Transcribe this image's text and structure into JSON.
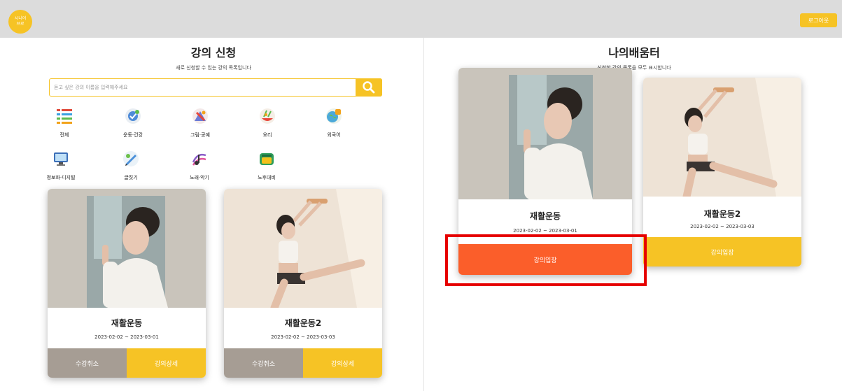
{
  "header": {
    "logo_text": "시니어 브로",
    "logout_label": "로그아웃"
  },
  "apply": {
    "title": "강의 신청",
    "subtitle": "새로 신청할 수 있는 강의 목록입니다",
    "search": {
      "placeholder": "듣고 싶은 강의 이름을 입력해주세요",
      "value": ""
    },
    "categories": [
      {
        "label": "전체",
        "icon": "list-icon"
      },
      {
        "label": "운동·건강",
        "icon": "health-icon"
      },
      {
        "label": "그림·공예",
        "icon": "art-icon"
      },
      {
        "label": "요리",
        "icon": "cooking-icon"
      },
      {
        "label": "외국어",
        "icon": "language-icon"
      },
      {
        "label": "정보화·디지털",
        "icon": "computer-icon"
      },
      {
        "label": "글짓기",
        "icon": "writing-icon"
      },
      {
        "label": "노래·악기",
        "icon": "music-icon"
      },
      {
        "label": "노후대비",
        "icon": "savings-icon"
      }
    ],
    "courses": [
      {
        "name": "재활운동",
        "period": "2023-02-02 ~ 2023-03-01",
        "cancel_label": "수강취소",
        "detail_label": "강의상세"
      },
      {
        "name": "재활운동2",
        "period": "2023-02-02 ~ 2023-03-03",
        "cancel_label": "수강취소",
        "detail_label": "강의상세"
      }
    ]
  },
  "my": {
    "title": "나의배움터",
    "subtitle": "신청한 강의 목록을 모두 표시합니다",
    "courses": [
      {
        "name": "재활운동",
        "period": "2023-02-02 ~ 2023-03-01",
        "enter_label": "강의입장",
        "highlighted": true
      },
      {
        "name": "재활운동2",
        "period": "2023-02-02 ~ 2023-03-03",
        "enter_label": "강의입장",
        "highlighted": false
      }
    ]
  },
  "colors": {
    "accent": "#f6c325",
    "enter_active": "#fb5e2a",
    "cancel": "#a69d94",
    "highlight": "#e60000",
    "topbar": "#dcdcdc"
  }
}
